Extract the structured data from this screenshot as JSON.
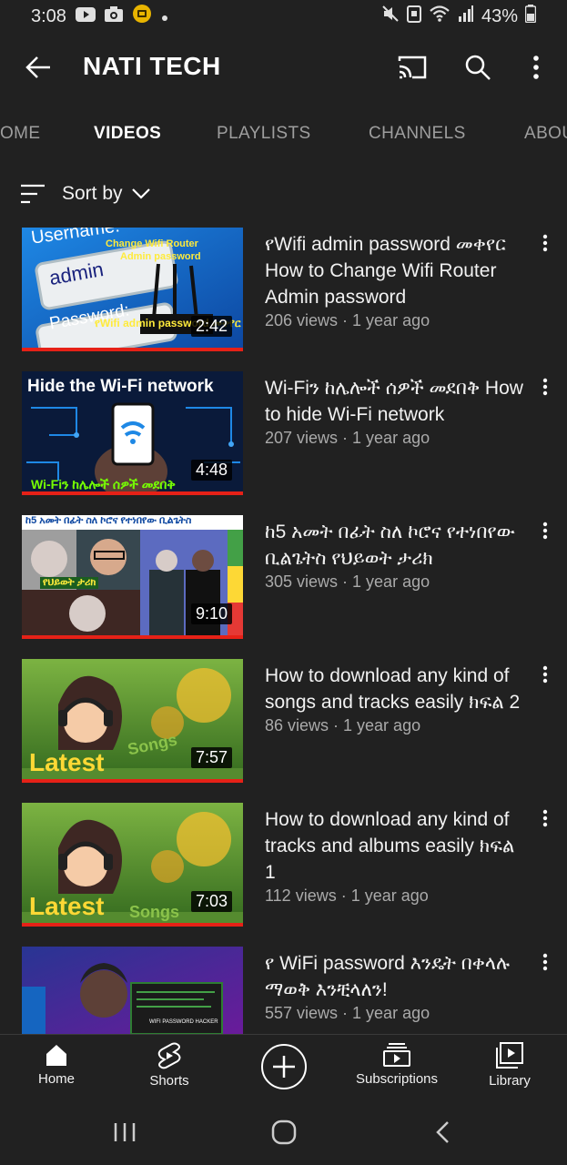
{
  "status_bar": {
    "time": "3:08",
    "battery": "43%"
  },
  "header": {
    "channel_name": "NATI TECH"
  },
  "tabs": [
    {
      "label": "HOME",
      "visible_text": "OME"
    },
    {
      "label": "VIDEOS",
      "visible_text": "VIDEOS",
      "active": true
    },
    {
      "label": "PLAYLISTS",
      "visible_text": "PLAYLISTS"
    },
    {
      "label": "CHANNELS",
      "visible_text": "CHANNELS"
    },
    {
      "label": "ABOUT",
      "visible_text": "ABOU"
    }
  ],
  "sort": {
    "label": "Sort by"
  },
  "videos": [
    {
      "title": "የWifi admin password መቀየር   How to Change Wifi Router Admin password",
      "meta": "206 views · 1 year ago",
      "duration": "2:42",
      "thumb_text": {
        "main": "admin",
        "top": "Change Wifi Router",
        "top2": "Admin password",
        "username": "Username:",
        "password": "Password:",
        "bottom": "የWifi admin password መቀየር"
      }
    },
    {
      "title": "Wi-Fiን ከሌሎች ሰዎች መደበቅ How to hide Wi-Fi network",
      "meta": "207 views · 1 year ago",
      "duration": "4:48",
      "thumb_text": {
        "main": "Hide the Wi-Fi network",
        "bottom": "Wi-Fiን ከሌሎች ሰዎች መደበቅ"
      }
    },
    {
      "title": "ከ5 አመት በፊት ስለ ኮሮና የተነበየው ቢልጌትስ የህይወት ታሪክ",
      "meta": "305 views · 1 year ago",
      "duration": "9:10",
      "thumb_text": {
        "main": "ከ5 አመት በፊት ስለ ኮሮና የተነበየው ቢልጌትስ",
        "bottom": "የህይወት ታሪክ"
      }
    },
    {
      "title": "How to download any kind of songs and tracks easily ክፍል 2",
      "meta": "86 views · 1 year ago",
      "duration": "7:57",
      "thumb_text": {
        "main": "Latest",
        "sub": "Songs"
      }
    },
    {
      "title": "How to download any kind of tracks and albums easily ክፍል 1",
      "meta": "112 views · 1 year ago",
      "duration": "7:03",
      "thumb_text": {
        "main": "Latest",
        "sub": "Songs"
      }
    },
    {
      "title": "የ WiFi password እንዴት በቀላሉ ማወቅ እንቺላለን!",
      "meta": "557 views · 1 year ago",
      "duration": "",
      "thumb_text": {
        "main": "WIFI PASSWORD HACKER"
      }
    }
  ],
  "bottom_nav": [
    {
      "label": "Home",
      "icon": "home-icon"
    },
    {
      "label": "Shorts",
      "icon": "shorts-icon"
    },
    {
      "label": "",
      "icon": "create-icon"
    },
    {
      "label": "Subscriptions",
      "icon": "subscriptions-icon"
    },
    {
      "label": "Library",
      "icon": "library-icon"
    }
  ],
  "colors": {
    "background": "#212121",
    "progress_red": "#e62117",
    "secondary_text": "#aaaaaa",
    "inactive_tab": "#9e9e9e"
  }
}
